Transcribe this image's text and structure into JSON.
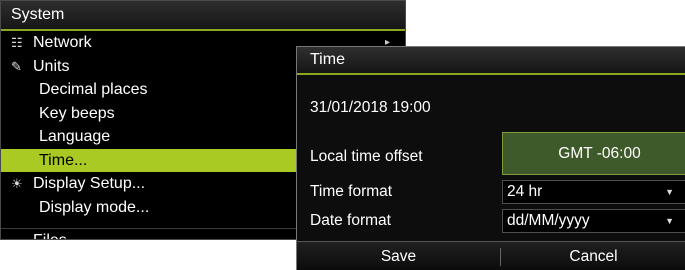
{
  "system_menu": {
    "title": "System",
    "items": [
      {
        "label": "Network",
        "icon": "network-icon",
        "glyph": "☷",
        "sub": false,
        "selected": false,
        "arrow": true
      },
      {
        "label": "Units",
        "icon": "pencil-icon",
        "glyph": "✎",
        "sub": false,
        "selected": false,
        "arrow": false
      },
      {
        "label": "Decimal places",
        "icon": "",
        "glyph": "",
        "sub": true,
        "selected": false,
        "arrow": false
      },
      {
        "label": "Key beeps",
        "icon": "",
        "glyph": "",
        "sub": true,
        "selected": false,
        "arrow": false
      },
      {
        "label": "Language",
        "icon": "",
        "glyph": "",
        "sub": true,
        "selected": false,
        "arrow": false
      },
      {
        "label": "Time...",
        "icon": "",
        "glyph": "",
        "sub": true,
        "selected": true,
        "arrow": false
      },
      {
        "label": "Display Setup...",
        "icon": "sun-icon",
        "glyph": "☀",
        "sub": false,
        "selected": false,
        "arrow": false
      },
      {
        "label": "Display mode...",
        "icon": "",
        "glyph": "",
        "sub": true,
        "selected": false,
        "arrow": false
      }
    ],
    "partial_item": "Files",
    "selected_color": "#a9c923"
  },
  "time_dialog": {
    "title": "Time",
    "datetime": "31/01/2018 19:00",
    "local_offset_label": "Local time offset",
    "local_offset_value": "GMT -06:00",
    "time_format_label": "Time format",
    "time_format_value": "24 hr",
    "date_format_label": "Date format",
    "date_format_value": "dd/MM/yyyy",
    "save_label": "Save",
    "cancel_label": "Cancel",
    "accent_color": "#8aa81e"
  }
}
